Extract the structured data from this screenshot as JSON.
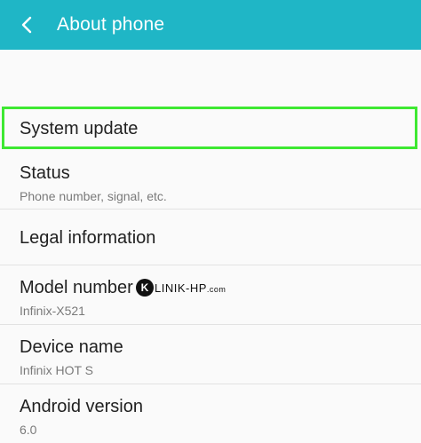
{
  "appbar": {
    "title": "About phone",
    "back_icon": "chevron-left-icon",
    "color": "#1fb6c6"
  },
  "items": [
    {
      "title": "System update",
      "subtitle": ""
    },
    {
      "title": "Status",
      "subtitle": "Phone number, signal, etc."
    },
    {
      "title": "Legal information",
      "subtitle": ""
    },
    {
      "title": "Model number",
      "subtitle": "Infinix-X521"
    },
    {
      "title": "Device name",
      "subtitle": "Infinix HOT S"
    },
    {
      "title": "Android version",
      "subtitle": "6.0"
    }
  ],
  "watermark": {
    "letter": "K",
    "text": "LINIK-HP",
    "suffix": ".com"
  },
  "highlight_color": "#3ee832"
}
